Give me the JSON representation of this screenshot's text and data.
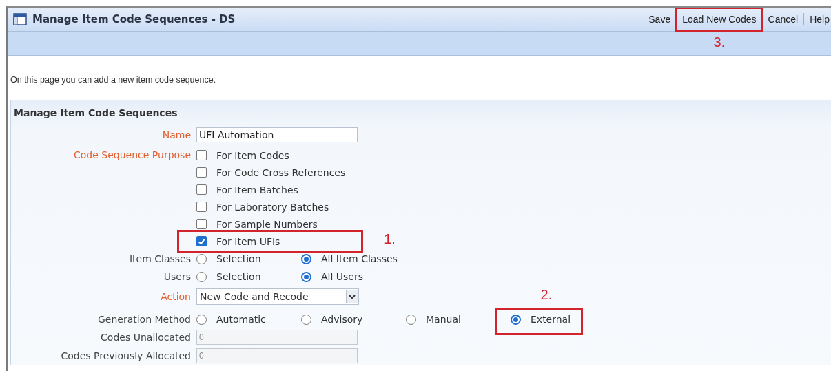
{
  "window": {
    "title": "Manage Item Code Sequences - DS"
  },
  "toolbar": [
    {
      "label": "Save"
    },
    {
      "label": "Load New Codes",
      "callout": {
        "label": "3."
      }
    },
    {
      "label": "Cancel"
    },
    {
      "label": "Help"
    }
  ],
  "intro": "On this page you can add a new item code sequence.",
  "section": {
    "title": "Manage Item Code Sequences",
    "fields": [
      {
        "kind": "text",
        "label": "Name",
        "required": true,
        "value": "UFI Automation"
      },
      {
        "kind": "checks",
        "label": "Code Sequence Purpose",
        "required": true,
        "options": [
          {
            "label": "For Item Codes",
            "checked": false
          },
          {
            "label": "For Code Cross References",
            "checked": false
          },
          {
            "label": "For Item Batches",
            "checked": false
          },
          {
            "label": "For Laboratory Batches",
            "checked": false
          },
          {
            "label": "For Sample Numbers",
            "checked": false
          },
          {
            "label": "For Item UFIs",
            "checked": true,
            "callout": {
              "label": "1."
            }
          }
        ]
      },
      {
        "kind": "radios",
        "label": "Item Classes",
        "required": false,
        "options": [
          {
            "label": "Selection",
            "selected": false
          },
          {
            "label": "All Item Classes",
            "selected": true
          }
        ]
      },
      {
        "kind": "radios",
        "label": "Users",
        "required": false,
        "options": [
          {
            "label": "Selection",
            "selected": false
          },
          {
            "label": "All Users",
            "selected": true
          }
        ]
      },
      {
        "kind": "select",
        "label": "Action",
        "required": true,
        "value": "New Code and Recode"
      },
      {
        "kind": "radios",
        "label": "Generation Method",
        "required": false,
        "options": [
          {
            "label": "Automatic",
            "selected": false
          },
          {
            "label": "Advisory",
            "selected": false
          },
          {
            "label": "Manual",
            "selected": false
          },
          {
            "label": "External",
            "selected": true,
            "callout": {
              "label": "2."
            }
          }
        ]
      },
      {
        "kind": "readonly",
        "label": "Codes Unallocated",
        "required": false,
        "value": "0"
      },
      {
        "kind": "readonly",
        "label": "Codes Previously Allocated",
        "required": false,
        "value": "0"
      }
    ]
  }
}
